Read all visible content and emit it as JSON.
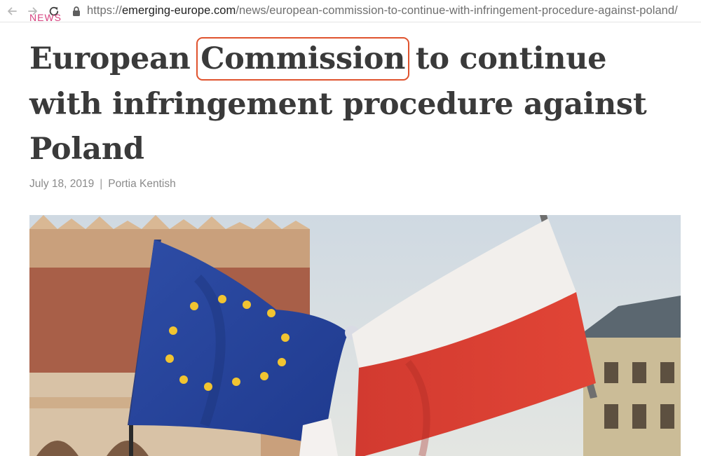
{
  "browser": {
    "url_protocol": "https://",
    "url_domain": "emerging-europe.com",
    "url_path": "/news/european-commission-to-continue-with-infringement-procedure-against-poland/",
    "icons": [
      "back-arrow-icon",
      "forward-arrow-icon",
      "reload-icon",
      "lock-icon"
    ]
  },
  "article": {
    "category": "NEWS",
    "title_before": "European ",
    "title_highlight": "Commission",
    "title_after": " to continue with infringement procedure against Poland",
    "date": "July 18, 2019",
    "separator": "|",
    "author": "Portia Kentish"
  },
  "colors": {
    "highlight_box": "#e0532e",
    "title": "#3a3a3a",
    "meta": "#8a8a8a",
    "category": "#d6427f"
  }
}
